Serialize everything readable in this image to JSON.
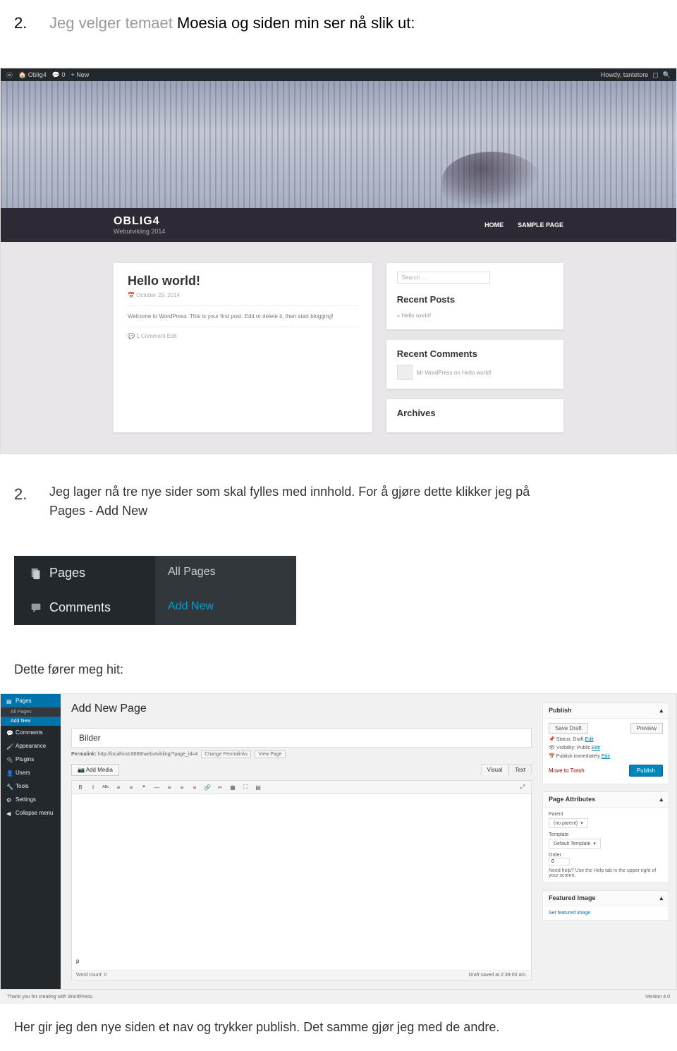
{
  "doc": {
    "heading1_num": "2.",
    "heading1_grey": "Jeg velger temaet ",
    "heading1_rest": "Moesia og siden min ser nå slik ut:",
    "heading2_num": "2.",
    "heading2_line1": "Jeg lager nå tre nye sider som skal fylles med innhold. For å gjøre dette klikker jeg på",
    "heading2_line2": "Pages - Add New",
    "para3": "Dette fører meg hit:",
    "para4": "Her gir jeg den nye siden et nav og trykker publish. Det samme gjør jeg med de andre."
  },
  "scr1": {
    "adminbar": {
      "site": "Oblig4",
      "comments": "0",
      "new": "New",
      "greeting": "Howdy, tantetore"
    },
    "brand": {
      "title": "OBLIG4",
      "sub": "Webutvikling 2014"
    },
    "nav": [
      "HOME",
      "SAMPLE PAGE"
    ],
    "post": {
      "title": "Hello world!",
      "date": "October 29, 2014",
      "body": "Welcome to WordPress. This is your first post. Edit or delete it, then start blogging!",
      "meta": "1 Comment   Edit"
    },
    "sidebar": {
      "search_ph": "Search …",
      "recent_posts_h": "Recent Posts",
      "recent_posts": [
        "Hello world!"
      ],
      "recent_comments_h": "Recent Comments",
      "recent_comments": [
        "Mr WordPress on Hello world!"
      ],
      "archives_h": "Archives"
    }
  },
  "scr2": {
    "pages": "Pages",
    "comments": "Comments",
    "all_pages": "All Pages",
    "add_new": "Add New"
  },
  "scr3": {
    "sidebar": {
      "pages": "Pages",
      "all_pages": "All Pages",
      "add_new": "Add New",
      "comments": "Comments",
      "appearance": "Appearance",
      "plugins": "Plugins",
      "users": "Users",
      "tools": "Tools",
      "settings": "Settings",
      "collapse": "Collapse menu"
    },
    "editor": {
      "page_title": "Add New Page",
      "title_value": "Bilder",
      "permalink_label": "Permalink:",
      "permalink_url": "http://localhost:8888/webutvikling/?page_id=4",
      "change_permalink": "Change Permalinks",
      "view_page": "View Page",
      "add_media": "Add Media",
      "tab_visual": "Visual",
      "tab_text": "Text",
      "toolbar": [
        "B",
        "I",
        "ᴬᴮᶜ",
        "≡",
        "≡",
        "❝",
        "—",
        "≡",
        "≡",
        "≡",
        "🔗",
        "✂",
        "▦",
        "⛶",
        "▤"
      ],
      "p_tag": "p",
      "word_count": "Word count: 0",
      "draft_saved": "Draft saved at 2:39:00 am."
    },
    "publish": {
      "h": "Publish",
      "save_draft": "Save Draft",
      "preview": "Preview",
      "status": "Status: Draft",
      "visibility": "Visibility: Public",
      "schedule": "Publish immediately",
      "edit": "Edit",
      "trash": "Move to Trash",
      "publish_btn": "Publish"
    },
    "attrs": {
      "h": "Page Attributes",
      "parent_l": "Parent",
      "parent_v": "(no parent)",
      "template_l": "Template",
      "template_v": "Default Template",
      "order_l": "Order",
      "order_v": "0",
      "help": "Need help? Use the Help tab in the upper right of your screen."
    },
    "featured": {
      "h": "Featured Image",
      "link": "Set featured image"
    },
    "footer": {
      "thanks": "Thank you for creating with WordPress.",
      "version": "Version 4.0"
    }
  }
}
